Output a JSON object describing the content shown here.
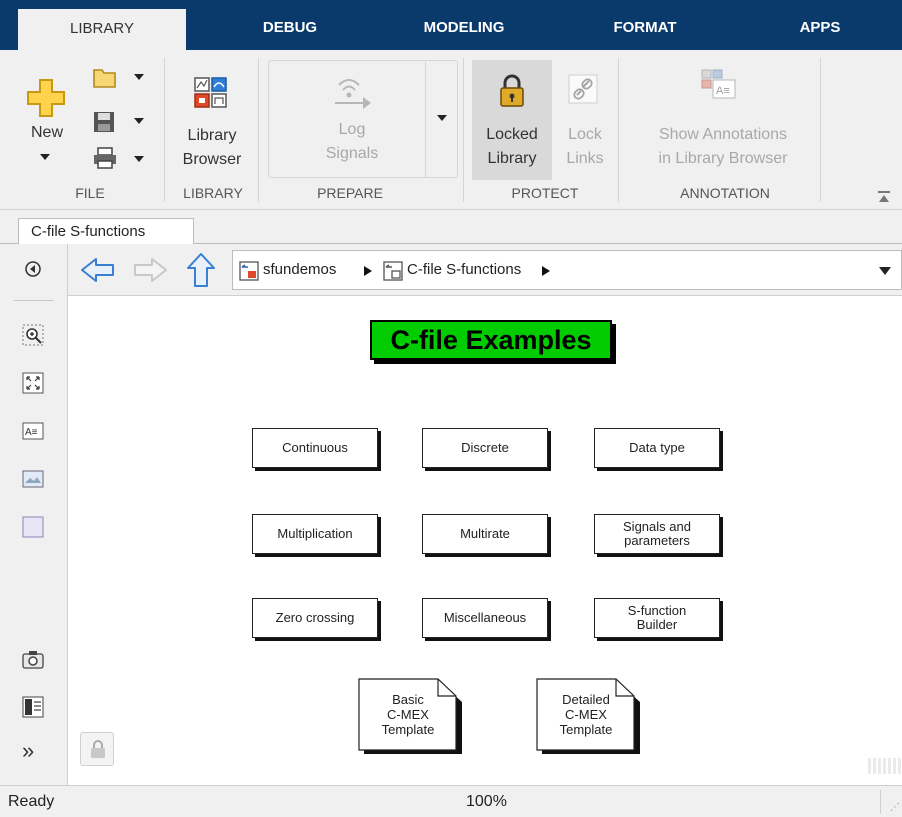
{
  "tabs": [
    {
      "label": "LIBRARY"
    },
    {
      "label": "DEBUG"
    },
    {
      "label": "MODELING"
    },
    {
      "label": "FORMAT"
    },
    {
      "label": "APPS"
    }
  ],
  "ribbon": {
    "file": {
      "new_label": "New",
      "section": "FILE"
    },
    "library": {
      "browser_line1": "Library",
      "browser_line2": "Browser",
      "section": "LIBRARY"
    },
    "prepare": {
      "log_line1": "Log",
      "log_line2": "Signals",
      "section": "PREPARE"
    },
    "protect": {
      "locked_line1": "Locked",
      "locked_line2": "Library",
      "lock_line1": "Lock",
      "lock_line2": "Links",
      "section": "PROTECT"
    },
    "annotation": {
      "show_line1": "Show Annotations",
      "show_line2": "in Library Browser",
      "section": "ANNOTATION"
    }
  },
  "doc_tab": {
    "label": "C-file S-functions"
  },
  "breadcrumb": {
    "root": "sfundemos",
    "current": "C-file S-functions"
  },
  "canvas": {
    "title": "C-file Examples",
    "blocks": {
      "continuous": "Continuous",
      "discrete": "Discrete",
      "data_type": "Data type",
      "multiplication": "Multiplication",
      "multirate": "Multirate",
      "signals_l1": "Signals and",
      "signals_l2": "parameters",
      "zero_crossing": "Zero crossing",
      "miscellaneous": "Miscellaneous",
      "sfb_l1": "S-function",
      "sfb_l2": "Builder"
    },
    "templates": {
      "basic": [
        "Basic",
        "C-MEX",
        "Template"
      ],
      "detailed": [
        "Detailed",
        "C-MEX",
        "Template"
      ]
    }
  },
  "status": {
    "left": "Ready",
    "zoom": "100%"
  },
  "colors": {
    "tabbar": "#0a3a6b",
    "title_green": "#00cc00",
    "nav_blue": "#3a7fd0"
  }
}
